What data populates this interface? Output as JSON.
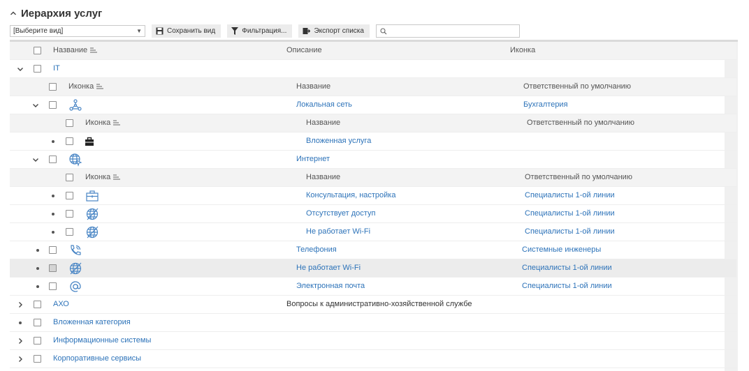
{
  "panel": {
    "title": "Иерархия услуг"
  },
  "toolbar": {
    "view_select": "[Выберите вид]",
    "save_view": "Сохранить вид",
    "filter": "Фильтрация...",
    "export": "Экспорт списка",
    "search_value": ""
  },
  "columns": {
    "name": "Название",
    "description": "Описание",
    "icon": "Иконка"
  },
  "subcolumns": {
    "icon": "Иконка",
    "name": "Название",
    "responsible": "Ответственный по умолчанию"
  },
  "rows": {
    "it": {
      "name": "IT"
    },
    "local_net": {
      "name": "Локальная сеть",
      "responsible": "Бухгалтерия",
      "icon": "network-nodes-icon"
    },
    "nested_service": {
      "name": "Вложенная услуга",
      "icon": "briefcase-icon"
    },
    "internet": {
      "name": "Интернет",
      "icon": "globe-cursor-icon"
    },
    "consult": {
      "name": "Консультация, настройка",
      "responsible": "Специалисты 1-ой линии",
      "icon": "briefcase-outline-icon"
    },
    "no_access": {
      "name": "Отсутствует доступ",
      "responsible": "Специалисты 1-ой линии",
      "icon": "globe-crossed-icon"
    },
    "no_wifi_nested": {
      "name": "Не работает Wi-Fi",
      "responsible": "Специалисты 1-ой линии",
      "icon": "globe-crossed-icon"
    },
    "telephony": {
      "name": "Телефония",
      "responsible": "Системные инженеры",
      "icon": "phone-icon"
    },
    "no_wifi": {
      "name": "Не работает Wi-Fi",
      "responsible": "Специалисты 1-ой линии",
      "icon": "globe-crossed-icon"
    },
    "email": {
      "name": "Электронная почта",
      "responsible": "Специалисты 1-ой линии",
      "icon": "at-sign-icon"
    },
    "axo": {
      "name": "АХО",
      "description": "Вопросы к административно-хозяйственной службе"
    },
    "nested_category": {
      "name": "Вложенная категория"
    },
    "info_systems": {
      "name": "Информационные системы"
    },
    "corp_services": {
      "name": "Корпоративные сервисы"
    }
  },
  "colors": {
    "link": "#2d73b9",
    "icon": "#4a86c5",
    "header_bg": "#f3f3f3",
    "selected_bg": "#ececec"
  }
}
